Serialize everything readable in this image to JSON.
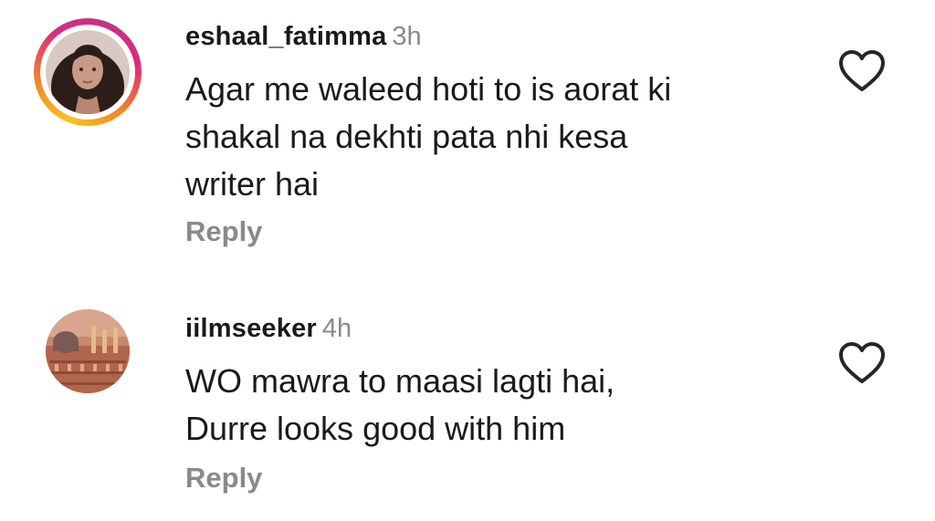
{
  "comments": [
    {
      "username": "eshaal_fatimma",
      "time": "3h",
      "text": "Agar me waleed hoti to is aorat ki\nshakal na dekhti pata nhi kesa\nwriter hai",
      "reply_label": "Reply",
      "avatar_has_story_ring": true,
      "like_icon": "heart-outline-icon"
    },
    {
      "username": "iilmseeker",
      "time": "4h",
      "text": "WO mawra to maasi lagti hai,\nDurre looks good with him",
      "reply_label": "Reply",
      "avatar_has_story_ring": false,
      "like_icon": "heart-outline-icon"
    }
  ],
  "colors": {
    "text": "#1a1a1a",
    "muted": "#8a8a8a",
    "story_ring": [
      "#f9c21a",
      "#f58529",
      "#dd2a7b",
      "#c13584"
    ]
  }
}
